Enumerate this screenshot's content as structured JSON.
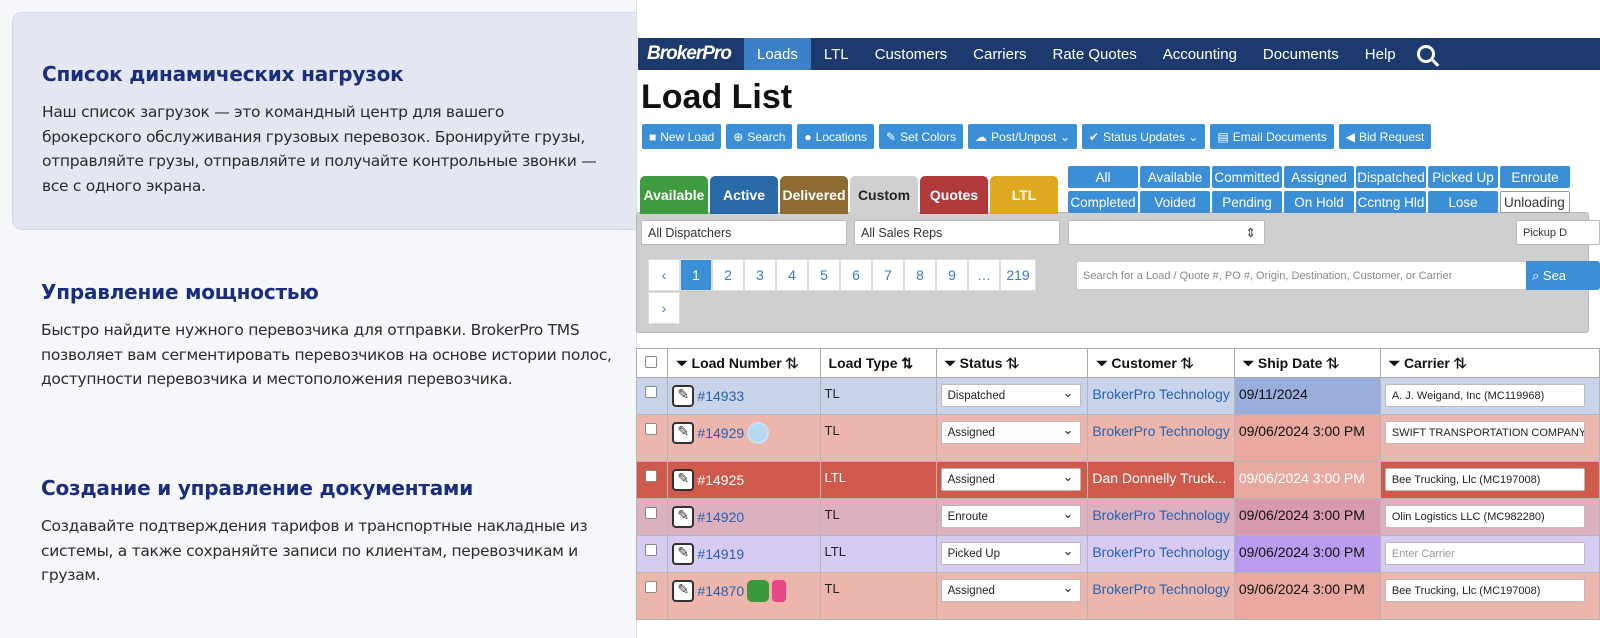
{
  "features": [
    {
      "title": "Список динамических нагрузок",
      "text": "Наш список загрузок — это командный центр для вашего брокерского обслуживания грузовых перевозок. Бронируйте грузы, отправляйте грузы, отправляйте и получайте контрольные звонки — все с одного экрана."
    },
    {
      "title": "Управление мощностью",
      "text": "Быстро найдите нужного перевозчика для отправки. BrokerPro TMS позволяет вам сегментировать перевозчиков на основе истории полос, доступности перевозчика и местоположения перевозчика."
    },
    {
      "title": "Создание и управление документами",
      "text": "Создавайте подтверждения тарифов и транспортные накладные из системы, а также сохраняйте записи по клиентам, перевозчикам и грузам."
    }
  ],
  "app": {
    "logo": "BrokerPro",
    "nav": [
      "Loads",
      "LTL",
      "Customers",
      "Carriers",
      "Rate Quotes",
      "Accounting",
      "Documents",
      "Help"
    ],
    "page_title": "Load List",
    "toolbar": [
      "New Load",
      "Search",
      "Locations",
      "Set Colors",
      "Post/Unpost",
      "Status Updates",
      "Email Documents",
      "Bid Request"
    ],
    "tabs": [
      {
        "label": "Available",
        "color": "#3f9b3f"
      },
      {
        "label": "Active",
        "color": "#2a6aa9"
      },
      {
        "label": "Delivered",
        "color": "#8c6a32"
      },
      {
        "label": "Custom",
        "color": "#d0d0d0"
      },
      {
        "label": "Quotes",
        "color": "#b03a3a"
      },
      {
        "label": "LTL",
        "color": "#e0a820"
      }
    ],
    "status_buttons": [
      "All",
      "Available",
      "Committed",
      "Assigned",
      "Dispatched",
      "Picked Up",
      "Enroute",
      "Completed",
      "Voided",
      "Pending",
      "On Hold",
      "Ccntng Hld",
      "Lose",
      "Unloading"
    ],
    "filters": {
      "dispatchers": "All Dispatchers",
      "sales_reps": "All Sales Reps",
      "pickup": "Pickup D"
    },
    "pages": [
      "‹",
      "1",
      "2",
      "3",
      "4",
      "5",
      "6",
      "7",
      "8",
      "9",
      "…",
      "219",
      "›"
    ],
    "search_placeholder": "Search for a Load / Quote #, PO #, Origin, Destination, Customer, or Carrier",
    "search_btn": "Sea",
    "columns": [
      "Load Number",
      "Load Type",
      "Status",
      "Customer",
      "Ship Date",
      "Carrier"
    ],
    "rows": [
      {
        "load": "#14933",
        "type": "TL",
        "status": "Dispatched",
        "customer": "BrokerPro Technology",
        "date": "09/11/2024",
        "carrier": "A. J. Weigand, Inc (MC119968)",
        "bg": "#c9d3ea",
        "datebg": "#9aaedb"
      },
      {
        "load": "#14929",
        "type": "TL",
        "status": "Assigned",
        "customer": "BrokerPro Technology",
        "date": "09/06/2024 3:00 PM",
        "carrier": "SWIFT TRANSPORTATION COMPANY",
        "bg": "#ecb6ad",
        "datebg": "#e9a9a0"
      },
      {
        "load": "#14925",
        "type": "LTL",
        "status": "Assigned",
        "customer": "Dan Donnelly Truck...",
        "date": "09/06/2024 3:00 PM",
        "carrier": "Bee Trucking, Llc (MC197008)",
        "bg": "#cf5a4c",
        "datebg": "#e7a9a0"
      },
      {
        "load": "#14920",
        "type": "TL",
        "status": "Enroute",
        "customer": "BrokerPro Technology",
        "date": "09/06/2024 3:00 PM",
        "carrier": "Olin Logistics LLC (MC982280)",
        "bg": "#ddb0c0",
        "datebg": "#d89aae"
      },
      {
        "load": "#14919",
        "type": "LTL",
        "status": "Picked Up",
        "customer": "BrokerPro Technology",
        "date": "09/06/2024 3:00 PM",
        "carrier": "Enter Carrier",
        "bg": "#d8cbf2",
        "datebg": "#b99cef"
      },
      {
        "load": "#14870",
        "type": "TL",
        "status": "Assigned",
        "customer": "BrokerPro Technology",
        "date": "09/06/2024 3:00 PM",
        "carrier": "Bee Trucking, Llc (MC197008)",
        "bg": "#ecb6ad",
        "datebg": "#e9a9a0"
      }
    ]
  }
}
